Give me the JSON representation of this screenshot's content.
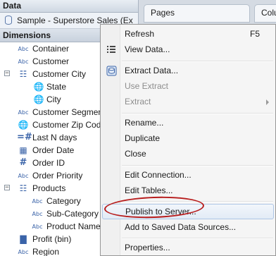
{
  "data_pane": {
    "title": "Data",
    "source": "Sample - Superstore Sales (Ex",
    "dimensions_label": "Dimensions",
    "fields": [
      {
        "type": "Abc",
        "label": "Container"
      },
      {
        "type": "Abc",
        "label": "Customer"
      },
      {
        "type": "hierarchy",
        "label": "Customer City",
        "toggle": "−"
      },
      {
        "type": "geo",
        "label": "State"
      },
      {
        "type": "geo",
        "label": "City"
      },
      {
        "type": "Abc",
        "label": "Customer Segment"
      },
      {
        "type": "geo",
        "label": "Customer Zip Code"
      },
      {
        "type": "#",
        "label": "Last N days"
      },
      {
        "type": "date",
        "label": "Order Date"
      },
      {
        "type": "#",
        "label": "Order ID"
      },
      {
        "type": "Abc",
        "label": "Order Priority"
      },
      {
        "type": "hierarchy",
        "label": "Products",
        "toggle": "−"
      },
      {
        "type": "Abc",
        "label": "Category"
      },
      {
        "type": "Abc",
        "label": "Sub-Category"
      },
      {
        "type": "Abc",
        "label": "Product Name"
      },
      {
        "type": "bin",
        "label": "Profit (bin)"
      },
      {
        "type": "Abc",
        "label": "Region"
      }
    ]
  },
  "shelves": {
    "pages_label": "Pages",
    "columns_label": "Colu"
  },
  "context_menu": {
    "items": [
      {
        "label": "Refresh",
        "shortcut": "F5"
      },
      {
        "label": "View Data...",
        "icon": "view-data-icon"
      },
      {
        "label": "Extract Data...",
        "icon": "extract-icon"
      },
      {
        "label": "Use Extract",
        "disabled": true
      },
      {
        "label": "Extract",
        "disabled": true,
        "submenu": true
      },
      {
        "label": "Rename..."
      },
      {
        "label": "Duplicate"
      },
      {
        "label": "Close"
      },
      {
        "label": "Edit Connection..."
      },
      {
        "label": "Edit Tables..."
      },
      {
        "label": "Publish to Server...",
        "highlighted": true
      },
      {
        "label": "Add to Saved Data Sources..."
      },
      {
        "label": "Properties..."
      }
    ]
  },
  "colors": {
    "annotation": "#b71c1c",
    "icon_blue": "#3a63a8",
    "menu_highlight_border": "#aec6e6"
  }
}
